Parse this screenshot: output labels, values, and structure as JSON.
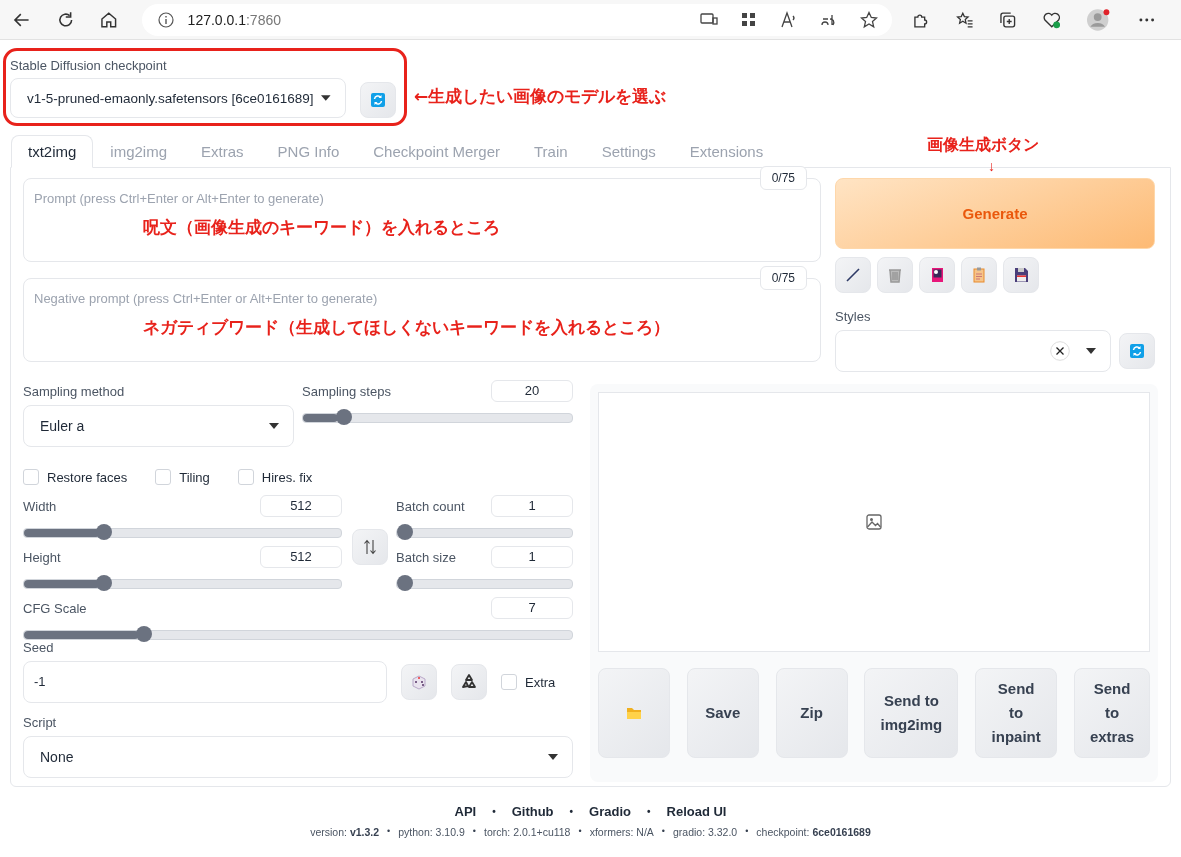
{
  "browser": {
    "url_host": "127.0.0.1",
    "url_port": ":7860"
  },
  "checkpoint": {
    "label": "Stable Diffusion checkpoint",
    "value": "v1-5-pruned-emaonly.safetensors [6ce0161689]",
    "annotation": "←生成したい画像のモデルを選ぶ"
  },
  "tabs": [
    {
      "label": "txt2img",
      "selected": true
    },
    {
      "label": "img2img",
      "selected": false
    },
    {
      "label": "Extras",
      "selected": false
    },
    {
      "label": "PNG Info",
      "selected": false
    },
    {
      "label": "Checkpoint Merger",
      "selected": false
    },
    {
      "label": "Train",
      "selected": false
    },
    {
      "label": "Settings",
      "selected": false
    },
    {
      "label": "Extensions",
      "selected": false
    }
  ],
  "prompt": {
    "placeholder": "Prompt (press Ctrl+Enter or Alt+Enter to generate)",
    "counter": "0/75",
    "annotation": "呪文（画像生成のキーワード）を入れるところ"
  },
  "negative_prompt": {
    "placeholder": "Negative prompt (press Ctrl+Enter or Alt+Enter to generate)",
    "counter": "0/75",
    "annotation": "ネガティブワード（生成してほしくないキーワードを入れるところ）"
  },
  "generate": {
    "label": "Generate",
    "annotation": "画像生成ボタン",
    "arrow": "↓"
  },
  "styles": {
    "label": "Styles"
  },
  "sampling_method": {
    "label": "Sampling method",
    "value": "Euler a"
  },
  "sampling_steps": {
    "label": "Sampling steps",
    "value": "20",
    "level": 0.13
  },
  "checkboxes": [
    {
      "label": "Restore faces",
      "checked": false
    },
    {
      "label": "Tiling",
      "checked": false
    },
    {
      "label": "Hires. fix",
      "checked": false
    }
  ],
  "width": {
    "label": "Width",
    "value": "512",
    "level": 0.24
  },
  "height": {
    "label": "Height",
    "value": "512",
    "level": 0.24
  },
  "batch_count": {
    "label": "Batch count",
    "value": "1",
    "level": 0
  },
  "batch_size": {
    "label": "Batch size",
    "value": "1",
    "level": 0
  },
  "cfg_scale": {
    "label": "CFG Scale",
    "value": "7",
    "level": 0.21
  },
  "seed": {
    "label": "Seed",
    "value": "-1"
  },
  "extra": {
    "label": "Extra",
    "checked": false
  },
  "script": {
    "label": "Script",
    "value": "None"
  },
  "output_buttons": [
    {
      "kind": "folder"
    },
    {
      "kind": "text",
      "label": "Save"
    },
    {
      "kind": "text",
      "label": "Zip"
    },
    {
      "kind": "text",
      "label": "Send to img2img"
    },
    {
      "kind": "text",
      "label": "Send to inpaint"
    },
    {
      "kind": "text",
      "label": "Send to extras"
    }
  ],
  "footer": {
    "links": [
      {
        "kind": "link",
        "text": "API"
      },
      {
        "kind": "sep",
        "text": "•"
      },
      {
        "kind": "link",
        "text": "Github"
      },
      {
        "kind": "sep",
        "text": "•"
      },
      {
        "kind": "link",
        "text": "Gradio"
      },
      {
        "kind": "sep",
        "text": "•"
      },
      {
        "kind": "link",
        "text": "Reload UI"
      }
    ],
    "info": [
      {
        "kind": "info",
        "text": "version: **v1.3.2**"
      },
      {
        "kind": "sep",
        "text": "•"
      },
      {
        "kind": "info",
        "text": "python: 3.10.9"
      },
      {
        "kind": "sep",
        "text": "•"
      },
      {
        "kind": "info",
        "text": "torch: 2.0.1+cu118"
      },
      {
        "kind": "sep",
        "text": "•"
      },
      {
        "kind": "info",
        "text": "xformers: N/A"
      },
      {
        "kind": "sep",
        "text": "•"
      },
      {
        "kind": "info",
        "text": "gradio: 3.32.0"
      },
      {
        "kind": "sep",
        "text": "•"
      },
      {
        "kind": "info",
        "text": "checkpoint: **6ce0161689**"
      }
    ]
  }
}
